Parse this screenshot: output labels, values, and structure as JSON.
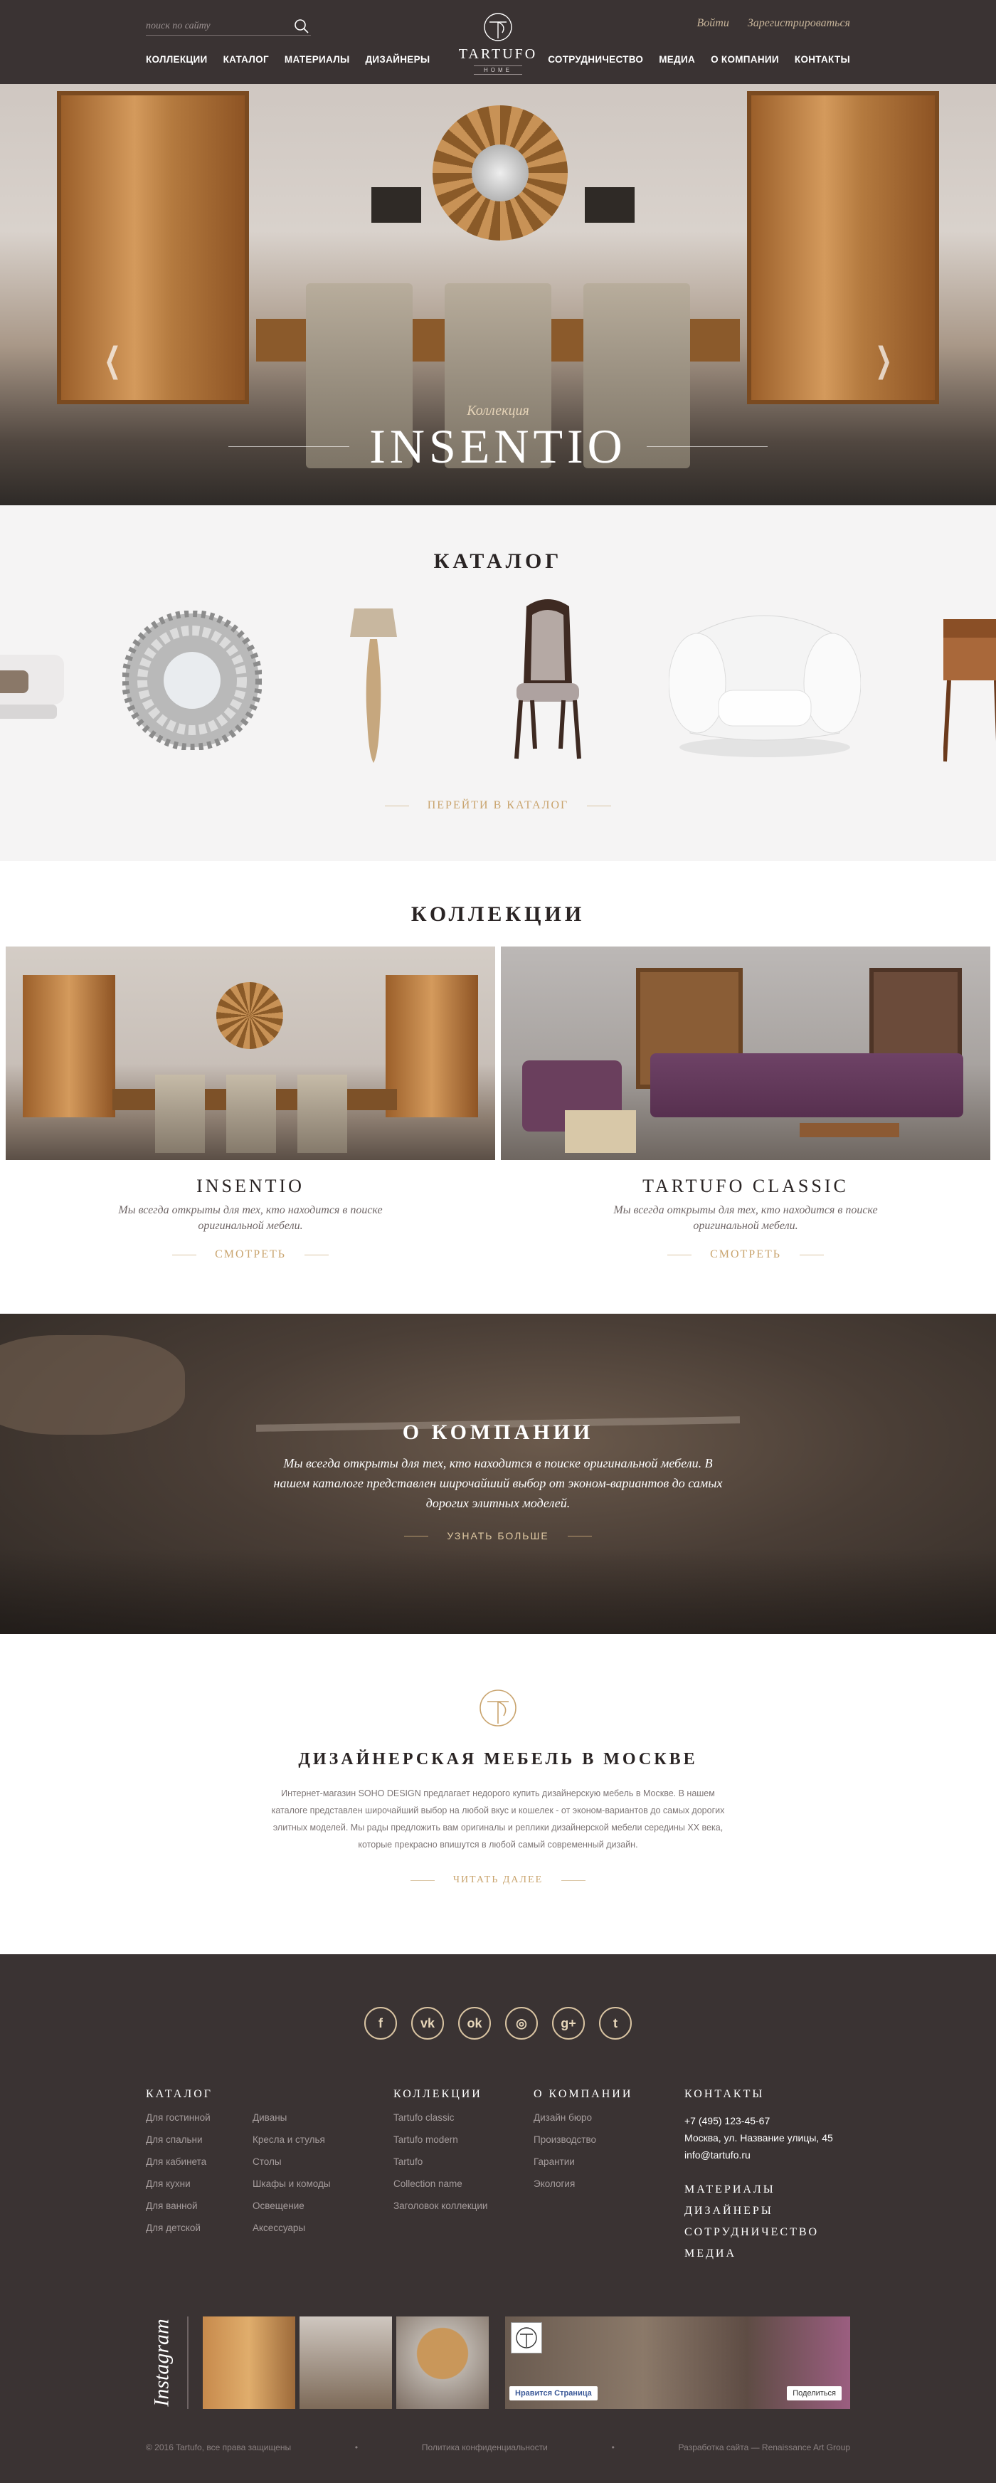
{
  "header": {
    "search_placeholder": "поиск по сайту",
    "logo_name": "TARTUFO",
    "logo_sub": "HOME",
    "login": "Войти",
    "register": "Зарегистрироваться",
    "nav_left": [
      "КОЛЛЕКЦИИ",
      "КАТАЛОГ",
      "МАТЕРИАЛЫ",
      "ДИЗАЙНЕРЫ"
    ],
    "nav_right": [
      "СОТРУДНИЧЕСТВО",
      "МЕДИА",
      "О КОМПАНИИ",
      "КОНТАКТЫ"
    ]
  },
  "hero": {
    "subtitle": "Коллекция",
    "title": "INSENTIO",
    "prev_icon": "chevron-left-icon",
    "next_icon": "chevron-right-icon"
  },
  "catalog": {
    "title": "КАТАЛОГ",
    "link": "ПЕРЕЙТИ В КАТАЛОГ",
    "items": [
      "sofa",
      "round-mirror",
      "floor-lamp",
      "chair",
      "armchair",
      "side-table"
    ]
  },
  "collections": {
    "title": "КОЛЛЕКЦИИ",
    "items": [
      {
        "name": "INSENTIO",
        "desc": "Мы всегда открыты для тех, кто находится в поиске оригинальной мебели.",
        "link": "СМОТРЕТЬ"
      },
      {
        "name": "TARTUFO CLASSIC",
        "desc": "Мы всегда открыты для тех, кто находится в поиске оригинальной мебели.",
        "link": "СМОТРЕТЬ"
      }
    ]
  },
  "about": {
    "title": "О КОМПАНИИ",
    "text": "Мы всегда открыты для тех, кто находится в поиске оригинальной мебели. В нашем каталоге представлен широчайший выбор от эконом-вариантов до самых дорогих элитных моделей.",
    "link": "УЗНАТЬ БОЛЬШЕ"
  },
  "design": {
    "title": "ДИЗАЙНЕРСКАЯ МЕБЕЛЬ В МОСКВЕ",
    "text": "Интернет-магазин SOHO DESIGN предлагает недорого купить дизайнерскую мебель в Москве. В нашем каталоге представлен широчайший выбор на любой вкус и кошелек - от эконом-вариантов до самых дорогих элитных моделей. Мы рады предложить вам оригиналы и реплики дизайнерской мебели середины XX века, которые прекрасно впишутся в любой самый современный дизайн.",
    "link": "ЧИТАТЬ ДАЛЕЕ"
  },
  "footer": {
    "socials": [
      "facebook-icon",
      "vk-icon",
      "odnoklassniki-icon",
      "instagram-icon",
      "googleplus-icon",
      "twitter-icon"
    ],
    "social_glyphs": [
      "f",
      "vk",
      "ok",
      "◎",
      "g+",
      "t"
    ],
    "catalog_title": "КАТАЛОГ",
    "catalog_links": [
      "Для гостинной",
      "Диваны",
      "Для спальни",
      "Кресла и стулья",
      "Для кабинета",
      "Столы",
      "Для кухни",
      "Шкафы и комоды",
      "Для ванной",
      "Освещение",
      "Для детской",
      "Аксессуары"
    ],
    "collections_title": "КОЛЛЕКЦИИ",
    "collections_links": [
      "Tartufo classic",
      "Tartufo modern",
      "Tartufo",
      "Collection name",
      "Заголовок коллекции"
    ],
    "about_title": "О КОМПАНИИ",
    "about_links": [
      "Дизайн бюро",
      "Производство",
      "Гарантии",
      "Экология"
    ],
    "contacts_title": "КОНТАКТЫ",
    "phone": "+7 (495) 123-45-67",
    "address": "Москва, ул. Название улицы, 45",
    "email": "info@tartufo.ru",
    "extra_links": [
      "МАТЕРИАЛЫ",
      "ДИЗАЙНЕРЫ",
      "СОТРУДНИЧЕСТВО",
      "МЕДИА"
    ],
    "instagram_label": "Instagram",
    "fb_like": "Нравится Страница",
    "fb_share": "Поделиться",
    "copyright": "© 2016 Tartufo, все права защищены",
    "privacy": "Политика конфиденциальности",
    "dev": "Разработка сайта — Renaissance Art Group"
  },
  "colors": {
    "dark": "#3a3333",
    "gold": "#c9a46e",
    "light_bg": "#f5f4f4"
  }
}
